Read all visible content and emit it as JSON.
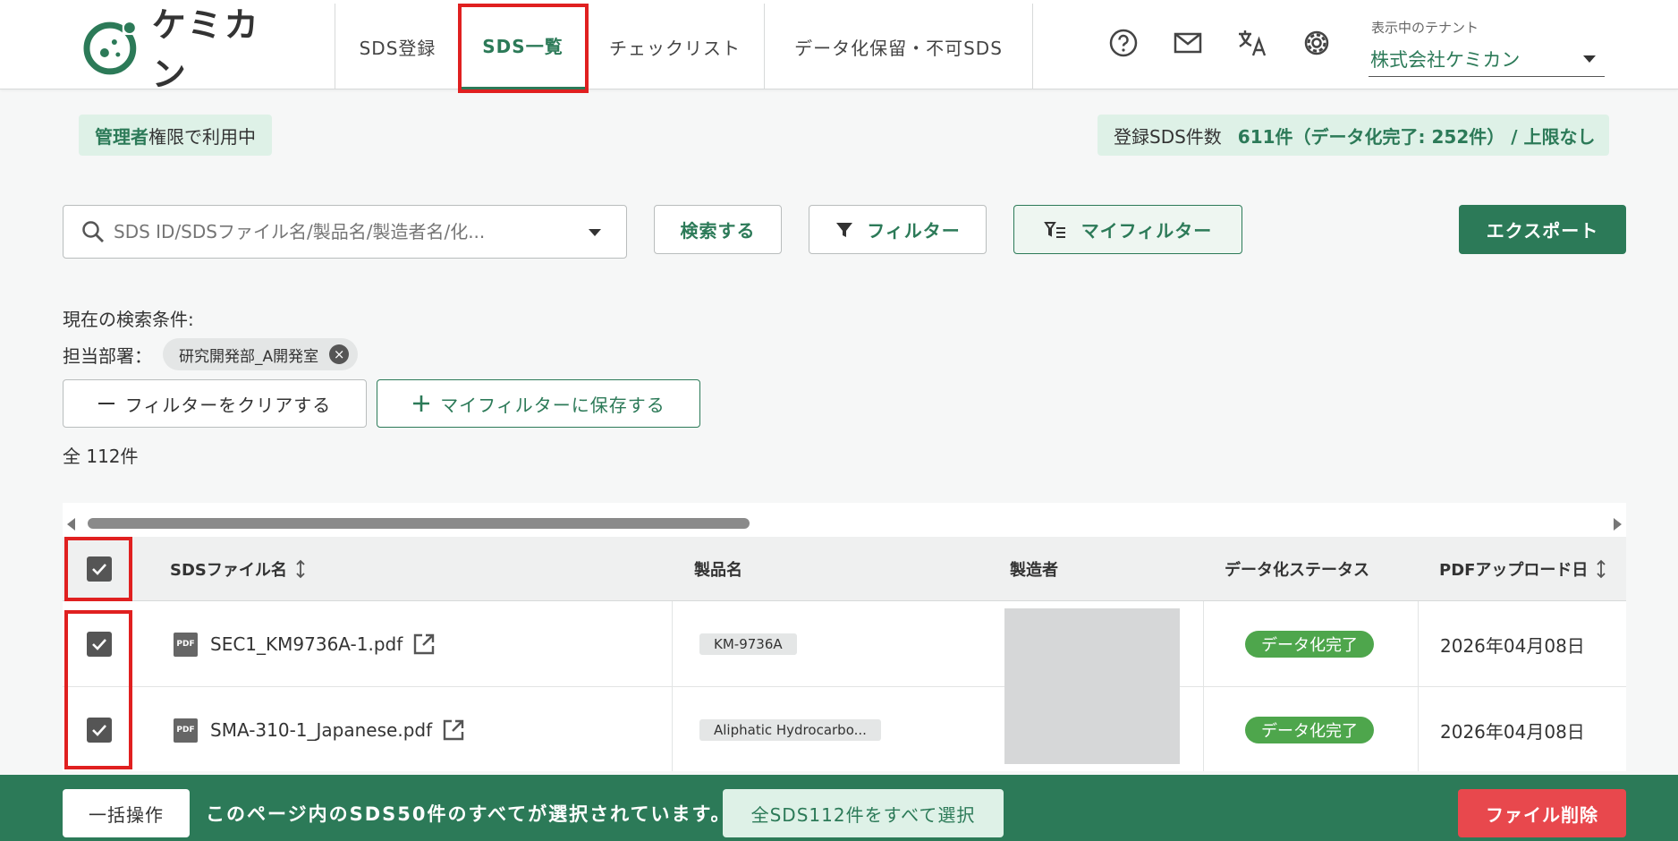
{
  "app": {
    "name": "ケミカン"
  },
  "nav": {
    "tabs": [
      {
        "label": "SDS登録",
        "active": false
      },
      {
        "label": "SDS一覧",
        "active": true
      },
      {
        "label": "チェックリスト",
        "active": false
      },
      {
        "label": "データ化保留・不可SDS",
        "active": false
      }
    ]
  },
  "header_icons": [
    "help-icon",
    "mail-icon",
    "translate-icon",
    "gear-icon"
  ],
  "tenant": {
    "label": "表示中のテナント",
    "value": "株式会社ケミカン"
  },
  "admin_badge": {
    "emphasis": "管理者",
    "rest": "権限で利用中"
  },
  "sds_count": {
    "label": "登録SDS件数",
    "value": "611件（データ化完了: 252件） / 上限なし"
  },
  "search": {
    "placeholder": "SDS ID/SDSファイル名/製品名/製造者名/化...",
    "search_button": "検索する",
    "filter_button": "フィルター",
    "my_filter_button": "マイフィルター",
    "export_button": "エクスポート"
  },
  "conditions": {
    "title": "現在の検索条件:",
    "label": "担当部署：",
    "chip": "研究開発部_A開発室",
    "clear_button": "フィルターをクリアする",
    "save_button": "マイフィルターに保存する"
  },
  "total": "全 112件",
  "table": {
    "columns": [
      "SDSファイル名",
      "製品名",
      "製造者",
      "データ化ステータス",
      "PDFアップロード日"
    ],
    "rows": [
      {
        "file": "SEC1_KM9736A-1.pdf",
        "product": "KM-9736A",
        "status": "データ化完了",
        "date": "2026年04月08日",
        "checked": true
      },
      {
        "file": "SMA-310-1_Japanese.pdf",
        "product": "Aliphatic Hydrocarbo...",
        "status": "データ化完了",
        "date": "2026年04月08日",
        "checked": true
      }
    ],
    "pdf_badge": "PDF"
  },
  "bottom_bar": {
    "bulk_button": "一括操作",
    "message": "このページ内のSDS50件のすべてが選択されています。",
    "select_all_button": "全SDS112件をすべて選択",
    "delete_button": "ファイル削除"
  },
  "colors": {
    "brand": "#2c7a58",
    "highlight": "#e02020",
    "danger": "#e8484d",
    "status": "#4ea64c"
  }
}
